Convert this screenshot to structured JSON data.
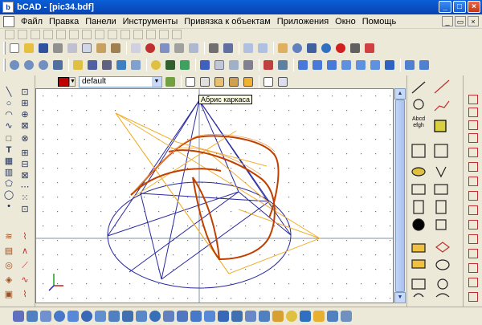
{
  "window": {
    "title": "bCAD - [pic34.bdf]",
    "app_icon": "bcad-app-icon",
    "minimize": "_",
    "maximize": "□",
    "close": "×"
  },
  "menu": {
    "items": [
      "Файл",
      "Правка",
      "Панели",
      "Инструменты",
      "Привязка к объектам",
      "Приложения",
      "Окно",
      "Помощь"
    ],
    "mdi_minimize": "_",
    "mdi_restore": "▭",
    "mdi_close": "×"
  },
  "properties": {
    "color": "#c00000",
    "layer_value": "default",
    "dropdown_arrow": "▼"
  },
  "canvas": {
    "tooltip": "Абрис каркаса",
    "background": "#ffffff",
    "colors": {
      "wireframe_blue": "#2a2aa0",
      "triangle_orange": "#f0b030",
      "section_red": "#c04000",
      "axis_gray": "#8090a8"
    }
  },
  "scrollbar": {
    "up": "▲",
    "down": "▼"
  },
  "right_panel": {
    "text_tool_label": "Abcd\nefgh",
    "text_tool_line1": "Abcd",
    "text_tool_line2": "efgh"
  }
}
